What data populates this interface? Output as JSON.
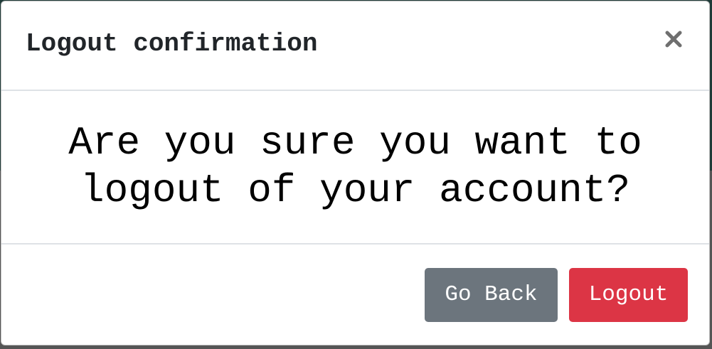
{
  "modal": {
    "title": "Logout confirmation",
    "close_icon": "close-icon",
    "message": "Are you sure you want to logout of your account?",
    "buttons": {
      "back_label": "Go Back",
      "logout_label": "Logout"
    }
  },
  "colors": {
    "secondary": "#6c757d",
    "danger": "#dc3545",
    "divider": "#dee2e6",
    "title_text": "#212529"
  }
}
